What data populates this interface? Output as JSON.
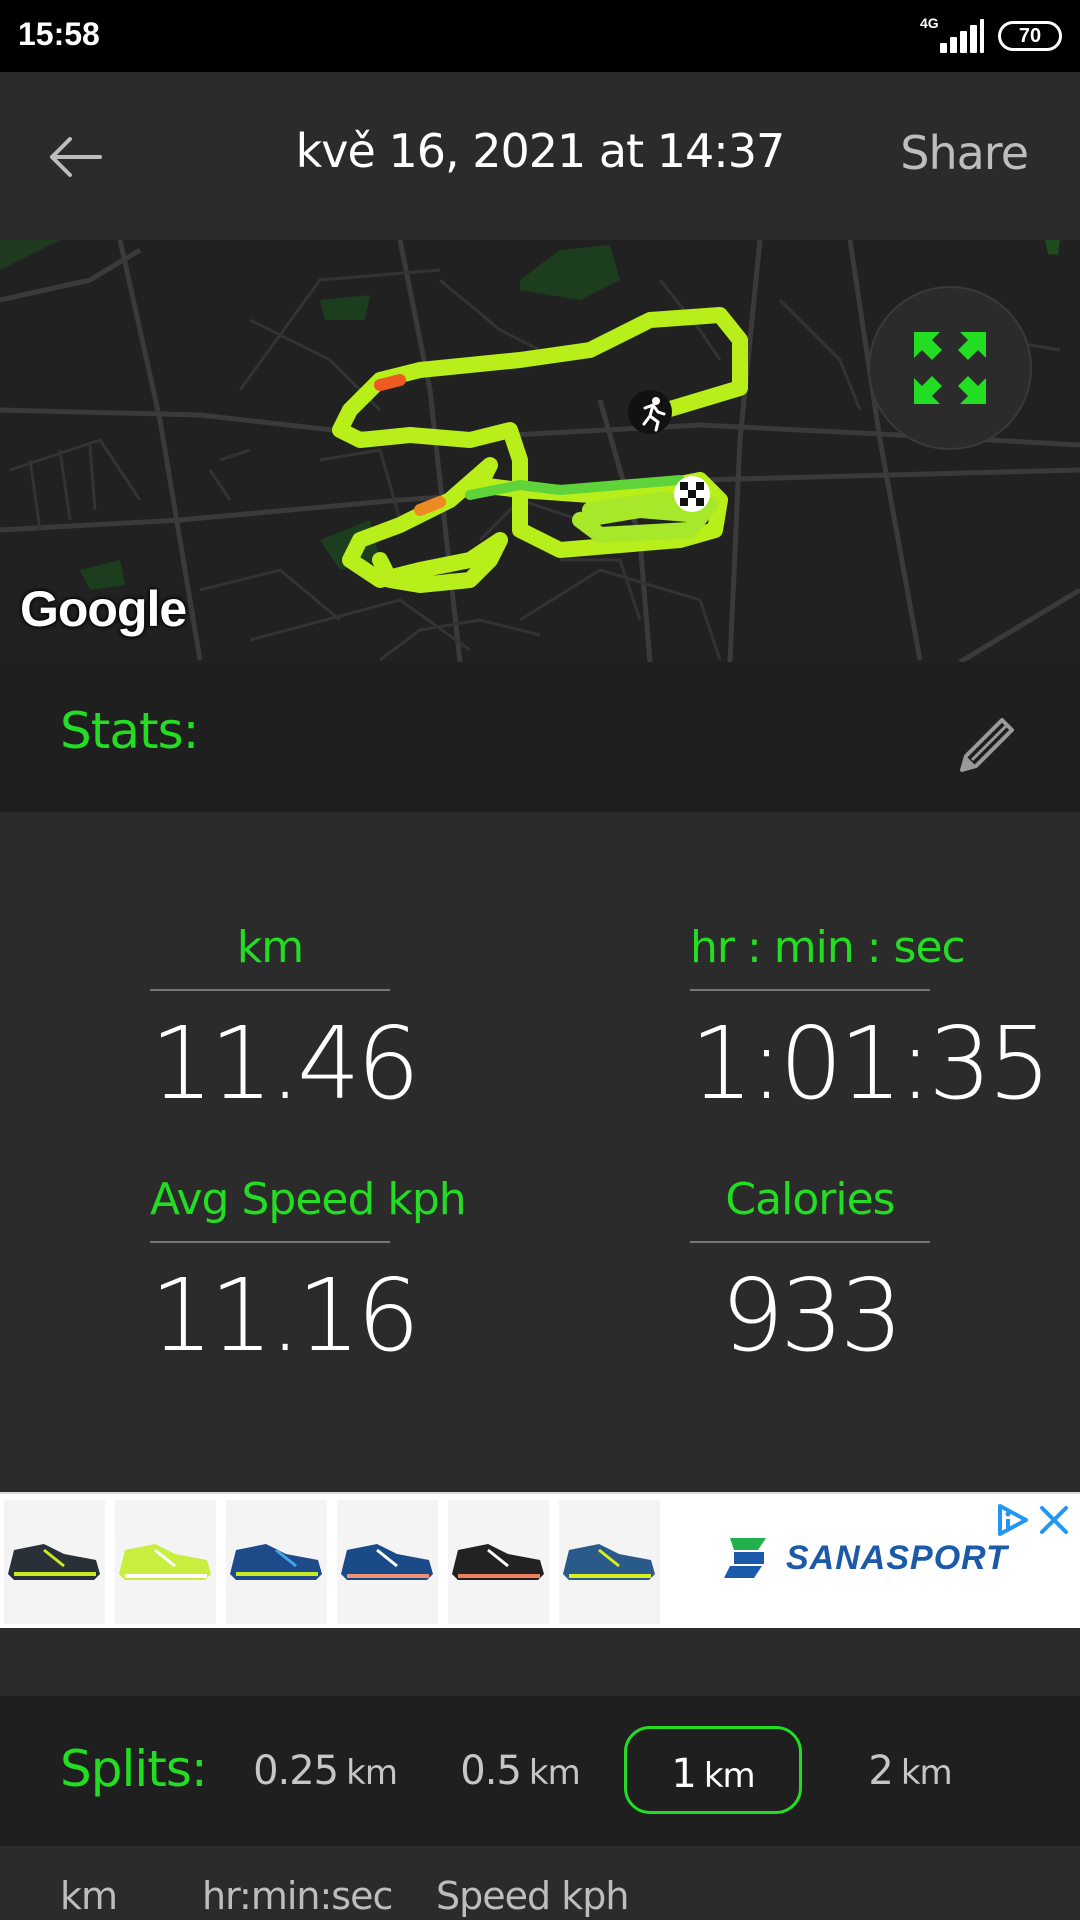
{
  "status_bar": {
    "time": "15:58",
    "network": "4G",
    "battery": "70"
  },
  "header": {
    "title": "kvě 16, 2021 at 14:37",
    "share_label": "Share",
    "back_icon": "arrow-left-icon"
  },
  "map": {
    "attribution": "Google",
    "fullscreen_icon": "expand-icon",
    "runner_icon": "runner-icon",
    "finish_icon": "checkered-flag-icon"
  },
  "stats": {
    "section_label": "Stats:",
    "edit_icon": "pencil-icon",
    "items": [
      {
        "label": "km",
        "value": "11.46"
      },
      {
        "label": "hr : min : sec",
        "value": "1:01:35"
      },
      {
        "label": "Avg Speed kph",
        "value": "11.16"
      },
      {
        "label": "Calories",
        "value": "933"
      }
    ]
  },
  "ad": {
    "brand": "SANASPORT",
    "info_icon": "adchoices-icon",
    "close_icon": "close-icon"
  },
  "splits": {
    "label": "Splits:",
    "options": [
      {
        "num": "0.25",
        "unit": "km",
        "selected": false
      },
      {
        "num": "0.5",
        "unit": "km",
        "selected": false
      },
      {
        "num": "1",
        "unit": "km",
        "selected": true
      },
      {
        "num": "2",
        "unit": "km",
        "selected": false
      }
    ],
    "columns": [
      "km",
      "hr:min:sec",
      "Speed kph"
    ]
  },
  "colors": {
    "accent": "#22dd22",
    "background": "#2b2b2b",
    "section_bg": "#1f1f1f"
  }
}
